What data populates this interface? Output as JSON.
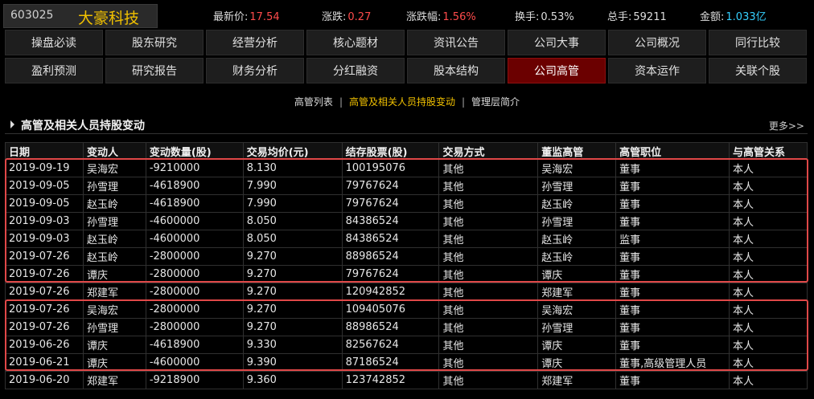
{
  "header": {
    "code": "603025",
    "name": "大豪科技",
    "quotes": [
      {
        "label": "最新价:",
        "value": "17.54",
        "color": "red"
      },
      {
        "label": "涨跌:",
        "value": "0.27",
        "color": "red"
      },
      {
        "label": "涨跌幅:",
        "value": "1.56%",
        "color": "red"
      },
      {
        "label": "换手:",
        "value": "0.53%",
        "color": "plain"
      },
      {
        "label": "总手:",
        "value": "59211",
        "color": "plain"
      },
      {
        "label": "金额:",
        "value": "1.033亿",
        "color": "cyan"
      }
    ]
  },
  "nav": {
    "row1": [
      "操盘必读",
      "股东研究",
      "经营分析",
      "核心题材",
      "资讯公告",
      "公司大事",
      "公司概况",
      "同行比较"
    ],
    "row2": [
      "盈利预测",
      "研究报告",
      "财务分析",
      "分红融资",
      "股本结构",
      "公司高管",
      "资本运作",
      "关联个股"
    ],
    "active": "公司高管"
  },
  "subtabs": {
    "items": [
      "高管列表",
      "高管及相关人员持股变动",
      "管理层简介"
    ],
    "current": "高管及相关人员持股变动",
    "separator": "|"
  },
  "section": {
    "title": "高管及相关人员持股变动",
    "more": "更多>>"
  },
  "table": {
    "columns": [
      "日期",
      "变动人",
      "变动数量(股)",
      "交易均价(元)",
      "结存股票(股)",
      "交易方式",
      "董监高管",
      "高管职位",
      "与高管关系"
    ],
    "rows": [
      [
        "2019-09-19",
        "吴海宏",
        "-9210000",
        "8.130",
        "100195076",
        "其他",
        "吴海宏",
        "董事",
        "本人"
      ],
      [
        "2019-09-05",
        "孙雪理",
        "-4618900",
        "7.990",
        "79767624",
        "其他",
        "孙雪理",
        "董事",
        "本人"
      ],
      [
        "2019-09-05",
        "赵玉岭",
        "-4618900",
        "7.990",
        "79767624",
        "其他",
        "赵玉岭",
        "董事",
        "本人"
      ],
      [
        "2019-09-03",
        "孙雪理",
        "-4600000",
        "8.050",
        "84386524",
        "其他",
        "孙雪理",
        "董事",
        "本人"
      ],
      [
        "2019-09-03",
        "赵玉岭",
        "-4600000",
        "8.050",
        "84386524",
        "其他",
        "赵玉岭",
        "监事",
        "本人"
      ],
      [
        "2019-07-26",
        "赵玉岭",
        "-2800000",
        "9.270",
        "88986524",
        "其他",
        "赵玉岭",
        "董事",
        "本人"
      ],
      [
        "2019-07-26",
        "谭庆",
        "-2800000",
        "9.270",
        "79767624",
        "其他",
        "谭庆",
        "董事",
        "本人"
      ],
      [
        "2019-07-26",
        "郑建军",
        "-2800000",
        "9.270",
        "120942852",
        "其他",
        "郑建军",
        "董事",
        "本人"
      ],
      [
        "2019-07-26",
        "吴海宏",
        "-2800000",
        "9.270",
        "109405076",
        "其他",
        "吴海宏",
        "董事",
        "本人"
      ],
      [
        "2019-07-26",
        "孙雪理",
        "-2800000",
        "9.270",
        "88986524",
        "其他",
        "孙雪理",
        "董事",
        "本人"
      ],
      [
        "2019-06-26",
        "谭庆",
        "-4618900",
        "9.330",
        "82567624",
        "其他",
        "谭庆",
        "董事",
        "本人"
      ],
      [
        "2019-06-21",
        "谭庆",
        "-4600000",
        "9.390",
        "87186524",
        "其他",
        "谭庆",
        "董事,高级管理人员",
        "本人"
      ],
      [
        "2019-06-20",
        "郑建军",
        "-9218900",
        "9.360",
        "123742852",
        "其他",
        "郑建军",
        "董事",
        "本人"
      ]
    ]
  },
  "colors": {
    "accent_red": "#ff4b4b",
    "accent_cyan": "#35d0ff",
    "name_gold": "#f0c000",
    "active_tab": "#6b0000",
    "highlight_box": "#e04848"
  }
}
